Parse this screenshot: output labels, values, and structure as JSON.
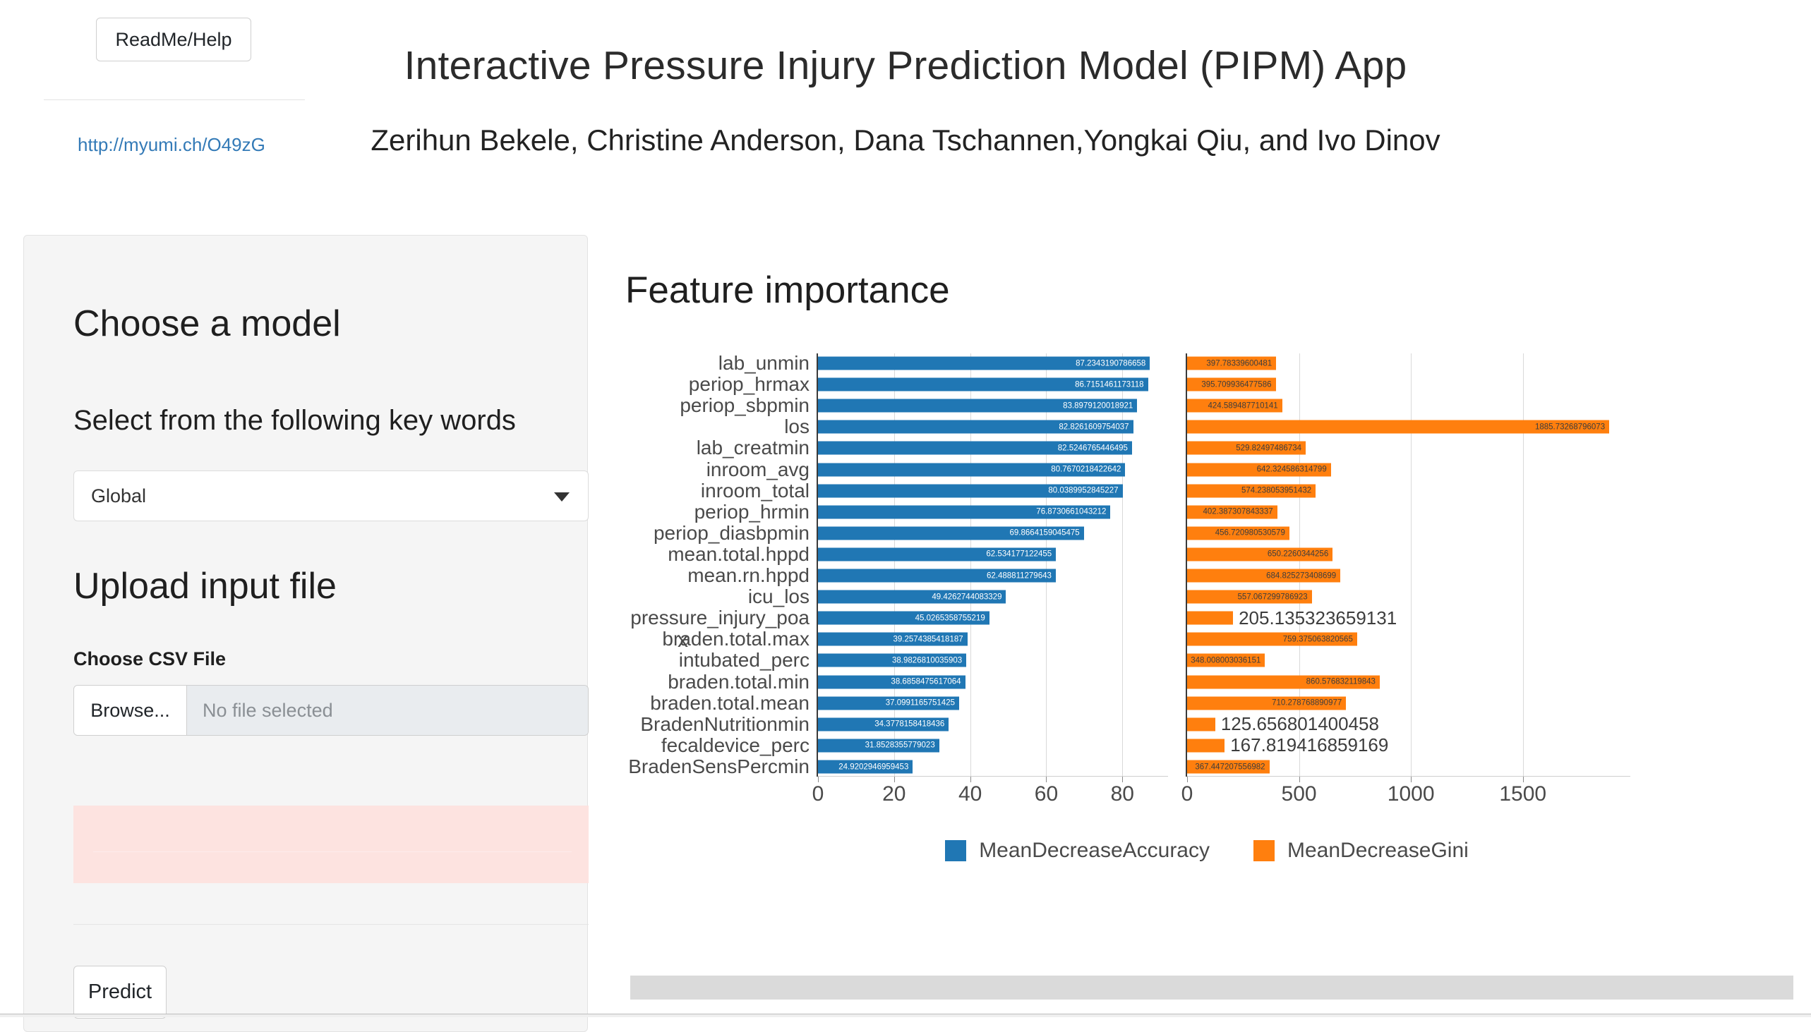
{
  "header": {
    "readme_button": "ReadMe/Help",
    "link": "http://myumi.ch/O49zG",
    "title": "Interactive Pressure Injury Prediction Model (PIPM) App",
    "authors": "Zerihun Bekele, Christine Anderson, Dana Tschannen,Yongkai Qiu, and Ivo Dinov"
  },
  "sidebar": {
    "choose_model_heading": "Choose a model",
    "keywords_label": "Select from the following key words",
    "model_selected": "Global",
    "upload_heading": "Upload input file",
    "csv_label": "Choose CSV File",
    "browse_button": "Browse...",
    "file_name": "No file selected",
    "predict_button": "Predict"
  },
  "main": {
    "title": "Feature importance"
  },
  "chart_data": {
    "type": "bar",
    "title": "Feature importance",
    "orientation": "horizontal",
    "ylabel": "x",
    "xlabel": "",
    "grid": true,
    "legend_position": "bottom",
    "categories": [
      "lab_unmin",
      "periop_hrmax",
      "periop_sbpmin",
      "los",
      "lab_creatmin",
      "inroom_avg",
      "inroom_total",
      "periop_hrmin",
      "periop_diasbpmin",
      "mean.total.hppd",
      "mean.rn.hppd",
      "icu_los",
      "pressure_injury_poa",
      "braden.total.max",
      "intubated_perc",
      "braden.total.min",
      "braden.total.mean",
      "BradenNutritionmin",
      "fecaldevice_perc",
      "BradenSensPercmin"
    ],
    "series": [
      {
        "name": "MeanDecreaseAccuracy",
        "color": "#2077b4",
        "xlim": [
          0,
          92
        ],
        "xticks": [
          0,
          20,
          40,
          60,
          80
        ],
        "values": [
          87.2343190786658,
          86.7151461173118,
          83.8979120018921,
          82.8261609754037,
          82.5246765446495,
          80.7670218422642,
          80.0389952845227,
          76.8730661043212,
          69.8664159045475,
          62.534177122455,
          62.488811279643,
          49.4262744083329,
          45.0265358755219,
          39.2574385418187,
          38.9826810035903,
          38.6858475617064,
          37.0991165751425,
          34.3778158418436,
          31.8528355779023,
          24.9202946959453
        ],
        "labels": [
          "87.2343190786658",
          "86.7151461173118",
          "83.8979120018921",
          "82.8261609754037",
          "82.5246765446495",
          "80.7670218422642",
          "80.0389952845227",
          "76.8730661043212",
          "69.8664159045475",
          "62.534177122455",
          "62.488811279643",
          "49.4262744083329",
          "45.0265358755219",
          "39.2574385418187",
          "38.9826810035903",
          "38.6858475617064",
          "37.0991165751425",
          "34.3778158418436",
          "31.8528355779023",
          "24.9202946959453"
        ]
      },
      {
        "name": "MeanDecreaseGini",
        "color": "#ff7f0e",
        "xlim": [
          0,
          1980
        ],
        "xticks": [
          0,
          500,
          1000,
          1500
        ],
        "values": [
          397.78339600481,
          395.709936477586,
          424.589487710141,
          1885.73268796073,
          529.82497486734,
          642.324586314799,
          574.238053951432,
          402.387307843337,
          456.720980530579,
          650.2260344256,
          684.825273408699,
          557.067299786923,
          205.135323659131,
          759.375063820565,
          348.008003036151,
          860.576832119843,
          710.278768890977,
          125.656801400458,
          167.819416859169,
          367.447207556982
        ],
        "labels": [
          "397.78339600481",
          "395.709936477586",
          "424.589487710141",
          "1885.73268796073",
          "529.82497486734",
          "642.324586314799",
          "574.238053951432",
          "402.387307843337",
          "456.720980530579",
          "650.2260344256",
          "684.825273408699",
          "557.067299786923",
          "205.135323659131",
          "759.375063820565",
          "348.008003036151",
          "860.576832119843",
          "710.278768890977",
          "125.656801400458",
          "167.819416859169",
          "367.447207556982"
        ],
        "outside_label_indices": [
          12,
          17,
          18
        ]
      }
    ]
  }
}
